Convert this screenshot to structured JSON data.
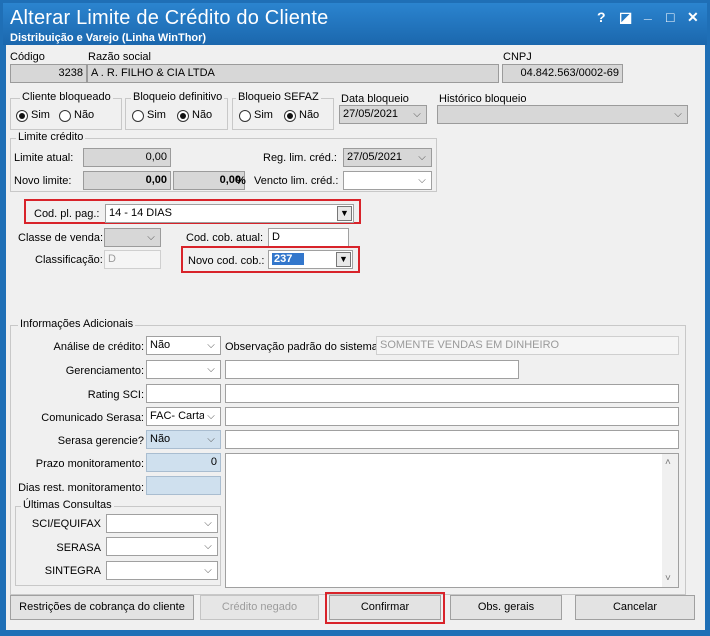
{
  "window": {
    "title": "Alterar Limite de Crédito do Cliente",
    "subtitle": "Distribuição e Varejo (Linha WinThor)",
    "help_glyph": "?",
    "restore_glyph": "◪",
    "minimize_glyph": "_",
    "maximize_glyph": "□",
    "close_glyph": "✕"
  },
  "client": {
    "codigo_label": "Código",
    "codigo": "3238",
    "razao_label": "Razão social",
    "razao": "A . R.  FILHO & CIA LTDA",
    "cnpj_label": "CNPJ",
    "cnpj": "04.842.563/0002-69"
  },
  "status": {
    "cliente_bloqueado": {
      "label": "Cliente bloqueado",
      "sim": "Sim",
      "nao": "Não",
      "selected": "Sim"
    },
    "bloqueio_definitivo": {
      "label": "Bloqueio definitivo",
      "sim": "Sim",
      "nao": "Não",
      "selected": "Não"
    },
    "bloqueio_sefaz": {
      "label": "Bloqueio SEFAZ",
      "sim": "Sim",
      "nao": "Não",
      "selected": "Não"
    },
    "data_bloqueio_label": "Data bloqueio",
    "data_bloqueio": "27/05/2021",
    "historico_label": "Histórico bloqueio",
    "historico": ""
  },
  "limite": {
    "group_label": "Limite crédito",
    "atual_label": "Limite atual:",
    "atual": "0,00",
    "novo_label": "Novo limite:",
    "novo": "0,00",
    "novo_pct": "0,00",
    "pct_symbol": "%",
    "reg_label": "Reg. lim. créd.:",
    "reg": "27/05/2021",
    "vencto_label": "Vencto lim. créd.:",
    "vencto": ""
  },
  "pagamento": {
    "cod_pl_label": "Cod. pl. pag.:",
    "cod_pl": "14 - 14 DIAS",
    "classe_label": "Classe de venda:",
    "classe": "",
    "cod_cob_atual_label": "Cod. cob. atual:",
    "cod_cob_atual": "D",
    "classificacao_label": "Classificação:",
    "classificacao": "D",
    "novo_cod_cob_label": "Novo cod. cob.:",
    "novo_cod_cob": "237"
  },
  "info": {
    "group_label": "Informações Adicionais",
    "analise_label": "Análise de crédito:",
    "analise": "Não",
    "obs_padrao_label": "Observação padrão do sistema:",
    "obs_padrao": "SOMENTE VENDAS EM DINHEIRO",
    "gerenciamento_label": "Gerenciamento:",
    "gerenciamento": "",
    "rating_label": "Rating SCI:",
    "rating": "",
    "comunicado_label": "Comunicado Serasa:",
    "comunicado": "FAC- Carta",
    "serasa_gerencie_label": "Serasa gerencie?",
    "serasa_gerencie": "Não",
    "prazo_label": "Prazo monitoramento:",
    "prazo": "0",
    "dias_label": "Dias rest. monitoramento:",
    "dias": ""
  },
  "consultas": {
    "group_label": "Últimas Consultas",
    "sci_label": "SCI/EQUIFAX",
    "serasa_label": "SERASA",
    "sintegra_label": "SINTEGRA"
  },
  "buttons": {
    "restricoes": "Restrições de cobrança do cliente",
    "credito_negado": "Crédito negado",
    "confirmar": "Confirmar",
    "obs_gerais": "Obs. gerais",
    "cancelar": "Cancelar"
  },
  "colors": {
    "titlebar": "#1f6fb6",
    "highlight_red": "#d8232a",
    "selected_blue": "#3377cc"
  },
  "icons": {
    "combo": "chevron-down-icon",
    "scroll_up": "chevron-up-icon",
    "scroll_down": "chevron-down-icon"
  }
}
